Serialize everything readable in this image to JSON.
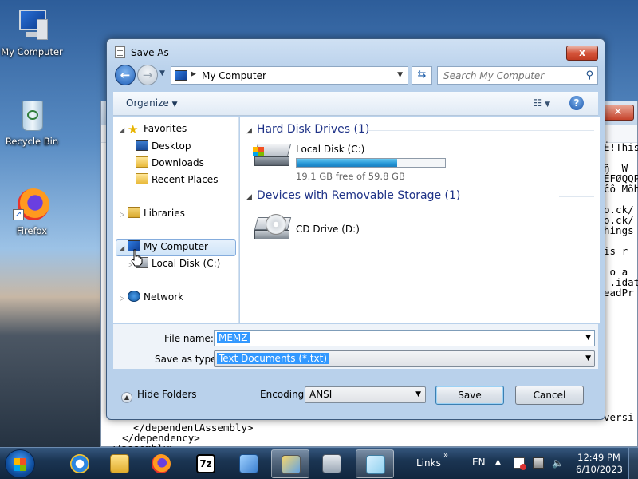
{
  "desktop": {
    "icons": [
      {
        "label": "My Computer"
      },
      {
        "label": "Recycle Bin"
      },
      {
        "label": "Firefox"
      }
    ]
  },
  "background_window": {
    "lines_right": [
      "Ė!This",
      "ñ  W",
      "ÉFØQQP",
      "ĉô Mõh",
      "o.ck/",
      "o.ck/",
      "hings",
      "is r",
      " o a",
      " .idat",
      "eadPr",
      "versi"
    ],
    "lines_bottom": [
      "</dependentAssembly>",
      "</dependency>",
      "</assembly>"
    ]
  },
  "dialog": {
    "title": "Save As",
    "close_label": "x",
    "address": "My Computer",
    "search_placeholder": "Search My Computer",
    "organize_label": "Organize",
    "nav": {
      "favorites": "Favorites",
      "desktop": "Desktop",
      "downloads": "Downloads",
      "recent": "Recent Places",
      "libraries": "Libraries",
      "my_computer": "My Computer",
      "local_disk": "Local Disk (C:)",
      "network": "Network"
    },
    "groups": {
      "hdd_header": "Hard Disk Drives (1)",
      "removable_header": "Devices with Removable Storage (1)"
    },
    "drives": {
      "c_name": "Local Disk (C:)",
      "c_free": "19.1 GB free of 59.8 GB",
      "c_used_fraction": 0.68,
      "d_name": "CD Drive (D:)"
    },
    "file_name_label": "File name:",
    "file_name_value": "MEMZ",
    "save_type_label": "Save as type:",
    "save_type_value": "Text Documents (*.txt)",
    "hide_folders": "Hide Folders",
    "encoding_label": "Encoding:",
    "encoding_value": "ANSI",
    "save_button": "Save",
    "cancel_button": "Cancel"
  },
  "taskbar": {
    "links_label": "Links",
    "lang": "EN",
    "time": "12:49 PM",
    "date": "6/10/2023",
    "zip_label": "7z"
  },
  "colors": {
    "accent": "#3399ff",
    "header_blue": "#1e3287",
    "drive_bar": "#2496d6"
  }
}
